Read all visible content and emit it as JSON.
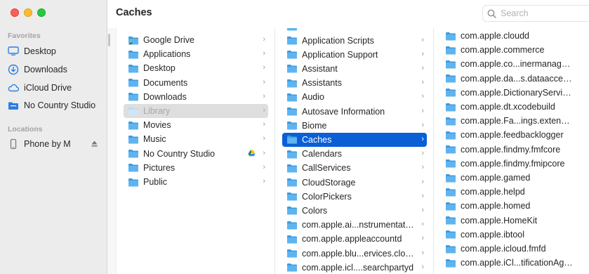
{
  "window": {
    "title": "Caches"
  },
  "search": {
    "placeholder": "Search"
  },
  "sidebar": {
    "favorites_header": "Favorites",
    "favorites": [
      {
        "label": "Desktop",
        "icon": "desktop-icon"
      },
      {
        "label": "Downloads",
        "icon": "download-circle-icon"
      },
      {
        "label": "iCloud Drive",
        "icon": "cloud-icon"
      },
      {
        "label": "No Country Studio",
        "icon": "folder-icon"
      }
    ],
    "locations_header": "Locations",
    "locations": [
      {
        "label": "Phone by M",
        "icon": "phone-icon"
      }
    ]
  },
  "columns": {
    "col1": [
      {
        "label": "Google Drive",
        "icon": "google-drive-folder-icon"
      },
      {
        "label": "Applications",
        "icon": "folder-icon"
      },
      {
        "label": "Desktop",
        "icon": "folder-icon"
      },
      {
        "label": "Documents",
        "icon": "folder-icon"
      },
      {
        "label": "Downloads",
        "icon": "folder-icon"
      },
      {
        "label": "Library",
        "icon": "folder-icon",
        "state": "dim"
      },
      {
        "label": "Movies",
        "icon": "folder-icon"
      },
      {
        "label": "Music",
        "icon": "folder-icon"
      },
      {
        "label": "No Country Studio",
        "icon": "folder-icon",
        "badge": "google-drive-icon"
      },
      {
        "label": "Pictures",
        "icon": "folder-icon"
      },
      {
        "label": "Public",
        "icon": "folder-icon"
      }
    ],
    "col2": [
      {
        "label": "Application Scripts"
      },
      {
        "label": "Application Support"
      },
      {
        "label": "Assistant"
      },
      {
        "label": "Assistants"
      },
      {
        "label": "Audio"
      },
      {
        "label": "Autosave Information"
      },
      {
        "label": "Biome"
      },
      {
        "label": "Caches",
        "state": "selected"
      },
      {
        "label": "Calendars"
      },
      {
        "label": "CallServices"
      },
      {
        "label": "CloudStorage"
      },
      {
        "label": "ColorPickers"
      },
      {
        "label": "Colors"
      },
      {
        "label": "com.apple.ai...nstrumentation"
      },
      {
        "label": "com.apple.appleaccountd"
      },
      {
        "label": "com.apple.blu...ervices.cloud"
      },
      {
        "label": "com.apple.icl....searchpartyd"
      }
    ],
    "col3": [
      {
        "label": "com.apple.cloudd"
      },
      {
        "label": "com.apple.commerce"
      },
      {
        "label": "com.apple.co...inermanagerd"
      },
      {
        "label": "com.apple.da...s.dataaccessd"
      },
      {
        "label": "com.apple.DictionaryServices"
      },
      {
        "label": "com.apple.dt.xcodebuild"
      },
      {
        "label": "com.apple.Fa...ings.extension"
      },
      {
        "label": "com.apple.feedbacklogger"
      },
      {
        "label": "com.apple.findmy.fmfcore"
      },
      {
        "label": "com.apple.findmy.fmipcore"
      },
      {
        "label": "com.apple.gamed"
      },
      {
        "label": "com.apple.helpd"
      },
      {
        "label": "com.apple.homed"
      },
      {
        "label": "com.apple.HomeKit"
      },
      {
        "label": "com.apple.ibtool"
      },
      {
        "label": "com.apple.icloud.fmfd"
      },
      {
        "label": "com.apple.iCl...tificationAgent"
      }
    ]
  },
  "colors": {
    "accent": "#0a5fd7",
    "folder": "#5fb4f0",
    "folder_dark": "#3d9be0"
  }
}
